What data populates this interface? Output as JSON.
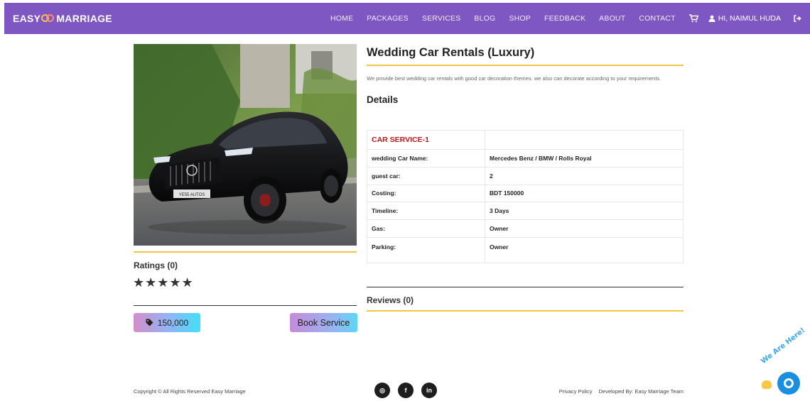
{
  "nav": {
    "brand_left": "EASY",
    "brand_right": "MARRIAGE",
    "links": [
      "HOME",
      "PACKAGES",
      "SERVICES",
      "BLOG",
      "SHOP",
      "FEEDBACK",
      "ABOUT",
      "CONTACT"
    ],
    "cart_icon": "cart-icon",
    "user_label": "HI, NAIMUL HUDA",
    "user_icon": "user-icon",
    "logout_icon": "logout-icon"
  },
  "service": {
    "title": "Wedding Car Rentals (Luxury)",
    "description": "We provide best wedding car rentals with good car decoration themes. we also can decorate according to your requirements.",
    "details_heading": "Details",
    "package_name": "CAR SERVICE-1",
    "rows": [
      {
        "label": "wedding Car Name:",
        "value": "Mercedes Benz / BMW / Rolls Royal"
      },
      {
        "label": "guest car:",
        "value": "2"
      },
      {
        "label": "Costing:",
        "value": "BDT 150000"
      },
      {
        "label": "Timeline:",
        "value": "3 Days"
      },
      {
        "label": "Gas:",
        "value": "Owner"
      },
      {
        "label": "Parking:",
        "value": "Owner"
      }
    ],
    "ratings_label": "Ratings (0)",
    "stars": "★★★★★",
    "price": "150,000",
    "book_label": "Book Service",
    "reviews_label": "Reviews (0)",
    "plate_text": "YE55 AUTOS"
  },
  "footer": {
    "copyright": "Copyright © All Rights Reserved Easy Marriage",
    "socials": [
      {
        "icon": "instagram-icon",
        "glyph": "◎"
      },
      {
        "icon": "facebook-icon",
        "glyph": "f"
      },
      {
        "icon": "linkedin-icon",
        "glyph": "in"
      }
    ],
    "privacy": "Privacy Policy",
    "developed": "Developed By: Easy Marriage Team"
  },
  "chat": {
    "badge": "We Are Here!"
  },
  "colors": {
    "nav_bg": "#7e57c2",
    "accent_line": "#f4c542",
    "package_red": "#c0181c",
    "chat_blue": "#1a8fe0"
  }
}
